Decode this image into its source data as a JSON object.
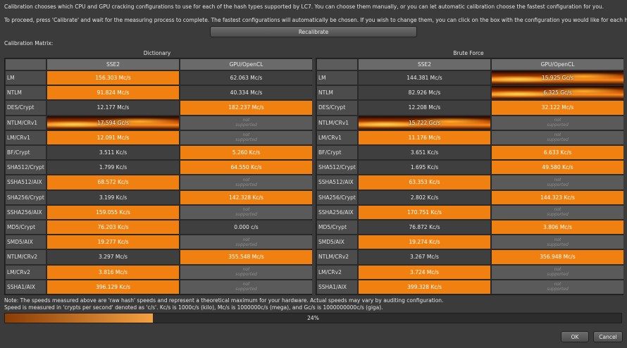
{
  "intro": {
    "line1": "Calibration chooses which  CPU and GPU cracking configurations to use for each of the hash types supported by LC7. You can choose them manually, or you can let automatic calibration choose the fastest configuration for you.",
    "line2": "To proceed, press 'Calibrate' and wait for the measuring process to complete. The fastest configurations will automatically be chosen. If you wish to change them, you can click on the box with the configuration you would like for each hash type."
  },
  "recalibrate_label": "Recalibrate",
  "matrix_label": "Calibration Matrix:",
  "not_supported": [
    "not",
    "supported"
  ],
  "panels": [
    {
      "title": "Dictionary",
      "columns": [
        "SSE2",
        "GPU/OpenCL"
      ],
      "rows": [
        {
          "label": "LM",
          "cells": [
            {
              "text": "156.303 Mc/s",
              "style": "orange"
            },
            {
              "text": "62.063 Mc/s",
              "style": "dark"
            }
          ]
        },
        {
          "label": "NTLM",
          "cells": [
            {
              "text": "91.824 Mc/s",
              "style": "orange"
            },
            {
              "text": "40.334 Mc/s",
              "style": "dark"
            }
          ]
        },
        {
          "label": "DES/Crypt",
          "cells": [
            {
              "text": "12.177 Mc/s",
              "style": "dark"
            },
            {
              "text": "182.237 Mc/s",
              "style": "orange"
            }
          ]
        },
        {
          "label": "NTLM/CRv1",
          "cells": [
            {
              "text": "17.594 Gc/s",
              "style": "fire"
            },
            {
              "text": "",
              "style": "ns"
            }
          ]
        },
        {
          "label": "LM/CRv1",
          "cells": [
            {
              "text": "12.091 Mc/s",
              "style": "orange"
            },
            {
              "text": "",
              "style": "ns"
            }
          ]
        },
        {
          "label": "BF/Crypt",
          "cells": [
            {
              "text": "3.511 Kc/s",
              "style": "dark"
            },
            {
              "text": "5.260 Kc/s",
              "style": "orange"
            }
          ]
        },
        {
          "label": "SHA512/Crypt",
          "cells": [
            {
              "text": "1.799 Kc/s",
              "style": "dark"
            },
            {
              "text": "64.550 Kc/s",
              "style": "orange"
            }
          ]
        },
        {
          "label": "SSHA512/AIX",
          "cells": [
            {
              "text": "68.572 Kc/s",
              "style": "orange"
            },
            {
              "text": "",
              "style": "ns"
            }
          ]
        },
        {
          "label": "SHA256/Crypt",
          "cells": [
            {
              "text": "3.199 Kc/s",
              "style": "dark"
            },
            {
              "text": "142.328 Kc/s",
              "style": "orange"
            }
          ]
        },
        {
          "label": "SSHA256/AIX",
          "cells": [
            {
              "text": "159.055 Kc/s",
              "style": "orange"
            },
            {
              "text": "",
              "style": "ns"
            }
          ]
        },
        {
          "label": "MD5/Crypt",
          "cells": [
            {
              "text": "76.203 Kc/s",
              "style": "orange"
            },
            {
              "text": "0.000 c/s",
              "style": "dark"
            }
          ]
        },
        {
          "label": "SMD5/AIX",
          "cells": [
            {
              "text": "19.277 Kc/s",
              "style": "orange"
            },
            {
              "text": "",
              "style": "ns"
            }
          ]
        },
        {
          "label": "NTLM/CRv2",
          "cells": [
            {
              "text": "3.297 Mc/s",
              "style": "dark"
            },
            {
              "text": "355.548 Mc/s",
              "style": "orange"
            }
          ]
        },
        {
          "label": "LM/CRv2",
          "cells": [
            {
              "text": "3.816 Mc/s",
              "style": "orange"
            },
            {
              "text": "",
              "style": "ns"
            }
          ]
        },
        {
          "label": "SSHA1/AIX",
          "cells": [
            {
              "text": "396.129 Kc/s",
              "style": "orange"
            },
            {
              "text": "",
              "style": "ns"
            }
          ]
        }
      ]
    },
    {
      "title": "Brute Force",
      "columns": [
        "SSE2",
        "GPU/OpenCL"
      ],
      "rows": [
        {
          "label": "LM",
          "cells": [
            {
              "text": "144.381 Mc/s",
              "style": "dark"
            },
            {
              "text": "15.925 Gc/s",
              "style": "fire"
            }
          ]
        },
        {
          "label": "NTLM",
          "cells": [
            {
              "text": "82.926 Mc/s",
              "style": "dark"
            },
            {
              "text": "6.325 Gc/s",
              "style": "fire"
            }
          ]
        },
        {
          "label": "DES/Crypt",
          "cells": [
            {
              "text": "12.208 Mc/s",
              "style": "dark"
            },
            {
              "text": "32.122 Mc/s",
              "style": "orange"
            }
          ]
        },
        {
          "label": "NTLM/CRv1",
          "cells": [
            {
              "text": "15.722 Gc/s",
              "style": "fire"
            },
            {
              "text": "",
              "style": "ns"
            }
          ]
        },
        {
          "label": "LM/CRv1",
          "cells": [
            {
              "text": "11.176 Mc/s",
              "style": "orange"
            },
            {
              "text": "",
              "style": "ns"
            }
          ]
        },
        {
          "label": "BF/Crypt",
          "cells": [
            {
              "text": "3.651 Kc/s",
              "style": "dark"
            },
            {
              "text": "6.633 Kc/s",
              "style": "orange"
            }
          ]
        },
        {
          "label": "SHA512/Crypt",
          "cells": [
            {
              "text": "1.695 Kc/s",
              "style": "dark"
            },
            {
              "text": "49.580 Kc/s",
              "style": "orange"
            }
          ]
        },
        {
          "label": "SSHA512/AIX",
          "cells": [
            {
              "text": "63.353 Kc/s",
              "style": "orange"
            },
            {
              "text": "",
              "style": "ns"
            }
          ]
        },
        {
          "label": "SHA256/Crypt",
          "cells": [
            {
              "text": "2.802 Kc/s",
              "style": "dark"
            },
            {
              "text": "144.323 Kc/s",
              "style": "orange"
            }
          ]
        },
        {
          "label": "SSHA256/AIX",
          "cells": [
            {
              "text": "170.751 Kc/s",
              "style": "orange"
            },
            {
              "text": "",
              "style": "ns"
            }
          ]
        },
        {
          "label": "MD5/Crypt",
          "cells": [
            {
              "text": "76.872 Kc/s",
              "style": "dark"
            },
            {
              "text": "3.806 Mc/s",
              "style": "orange"
            }
          ]
        },
        {
          "label": "SMD5/AIX",
          "cells": [
            {
              "text": "19.274 Kc/s",
              "style": "orange"
            },
            {
              "text": "",
              "style": "ns"
            }
          ]
        },
        {
          "label": "NTLM/CRv2",
          "cells": [
            {
              "text": "3.267 Mc/s",
              "style": "dark"
            },
            {
              "text": "356.948 Mc/s",
              "style": "orange"
            }
          ]
        },
        {
          "label": "LM/CRv2",
          "cells": [
            {
              "text": "3.724 Mc/s",
              "style": "orange"
            },
            {
              "text": "",
              "style": "ns"
            }
          ]
        },
        {
          "label": "SSHA1/AIX",
          "cells": [
            {
              "text": "399.328 Kc/s",
              "style": "orange"
            },
            {
              "text": "",
              "style": "ns"
            }
          ]
        }
      ]
    }
  ],
  "notes": {
    "line1": "Note: The speeds measured above are 'raw hash' speeds and represent a theoretical maximum for your hardware. Actual speeds may vary by auditing configuration.",
    "line2": "Speed is measured in 'crypts per second' denoted as 'c/s'. Kc/s is 1000c/s (kilo), Mc/s is 1000000c/s (mega), and Gc/s is 1000000000c/s (giga)."
  },
  "progress": {
    "fraction": 0.24,
    "label": "24%"
  },
  "buttons": {
    "ok": "OK",
    "cancel": "Cancel"
  }
}
